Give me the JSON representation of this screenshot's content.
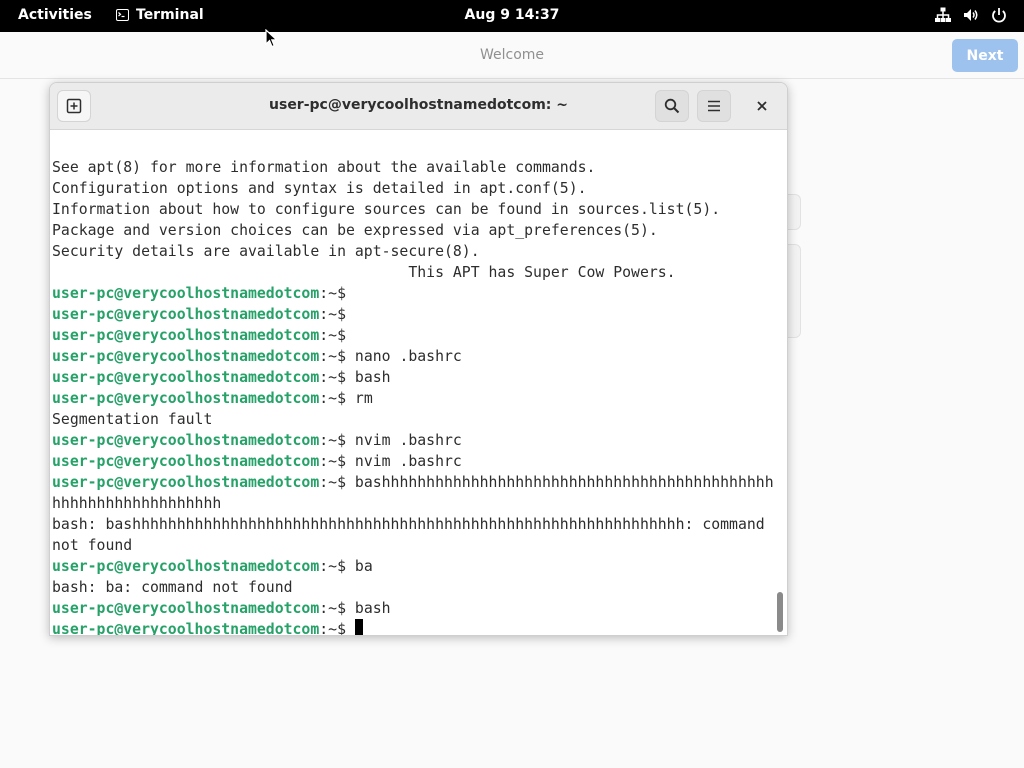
{
  "topbar": {
    "activities": "Activities",
    "app_name": "Terminal",
    "clock": "Aug 9  14:37",
    "icons": [
      "network-icon",
      "volume-icon",
      "power-icon"
    ]
  },
  "welcome": {
    "title": "Welcome",
    "next_label": "Next"
  },
  "terminal": {
    "title": "user-pc@verycoolhostnamedotcom: ~",
    "prompt_user": "user-pc@verycoolhostnamedotcom",
    "prompt_suffix": ":~$ ",
    "lines": [
      {
        "text": "See apt(8) for more information about the available commands."
      },
      {
        "text": "Configuration options and syntax is detailed in apt.conf(5)."
      },
      {
        "text": "Information about how to configure sources can be found in sources.list(5)."
      },
      {
        "text": "Package and version choices can be expressed via apt_preferences(5)."
      },
      {
        "text": "Security details are available in apt-secure(8)."
      },
      {
        "text": "                                        This APT has Super Cow Powers."
      },
      {
        "prompt": true,
        "cmd": ""
      },
      {
        "prompt": true,
        "cmd": ""
      },
      {
        "prompt": true,
        "cmd": ""
      },
      {
        "prompt": true,
        "cmd": "nano .bashrc"
      },
      {
        "prompt": true,
        "cmd": "bash"
      },
      {
        "prompt": true,
        "cmd": "rm"
      },
      {
        "text": "Segmentation fault"
      },
      {
        "prompt": true,
        "cmd": "nvim .bashrc"
      },
      {
        "prompt": true,
        "cmd": "nvim .bashrc"
      },
      {
        "prompt": true,
        "cmd": "bashhhhhhhhhhhhhhhhhhhhhhhhhhhhhhhhhhhhhhhhhhhhhh"
      },
      {
        "text": "hhhhhhhhhhhhhhhhhhh"
      },
      {
        "text": "bash: bashhhhhhhhhhhhhhhhhhhhhhhhhhhhhhhhhhhhhhhhhhhhhhhhhhhhhhhhhhhhhh: command"
      },
      {
        "text": "not found"
      },
      {
        "prompt": true,
        "cmd": "ba"
      },
      {
        "text": "bash: ba: command not found"
      },
      {
        "prompt": true,
        "cmd": "bash"
      },
      {
        "prompt": true,
        "cmd": "",
        "cursor": true
      }
    ]
  },
  "colors": {
    "prompt_green": "#26a269",
    "next_button_bg": "#9dc2ee",
    "topbar_bg": "#000000"
  }
}
